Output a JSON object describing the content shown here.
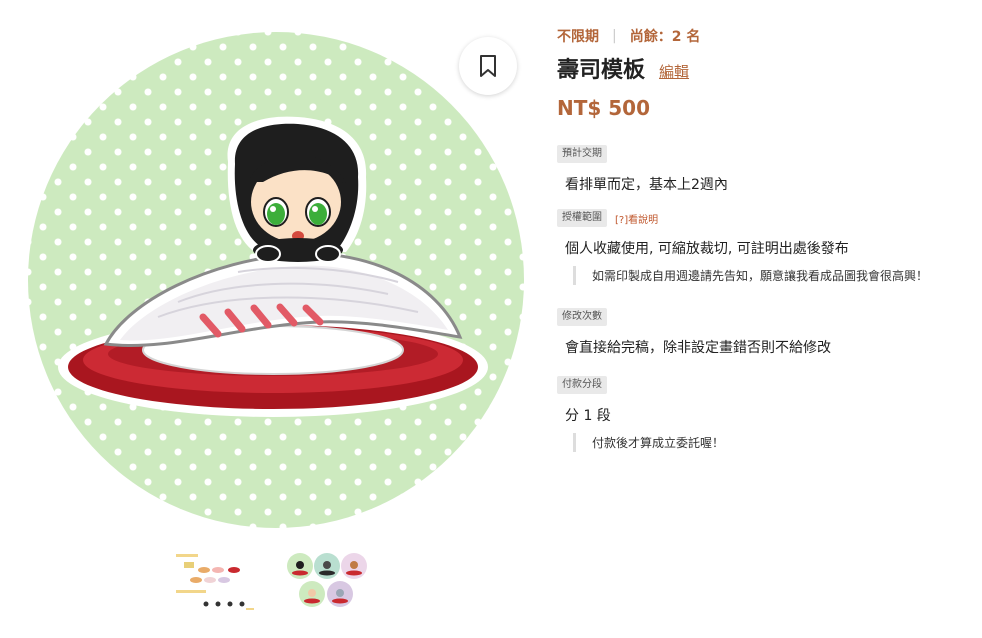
{
  "product": {
    "availability": "不限期",
    "stock": "尚餘：2 名",
    "title": "壽司模板",
    "edit_label": "編輯",
    "price": "NT$ 500"
  },
  "sections": [
    {
      "tag": "預計交期",
      "value": "看排單而定，基本上2週內"
    },
    {
      "tag": "授權範圍",
      "hint": "[?]看說明",
      "value": "個人收藏使用, 可縮放裁切, 可註明出處後發布",
      "note": "如需印製成自用週邊請先告知，願意讓我看成品圖我會很高興！"
    },
    {
      "tag": "修改次數",
      "value": "會直接給完稿，除非設定畫錯否則不給修改"
    },
    {
      "tag": "付款分段",
      "value": "分 1 段",
      "note": "付款後才算成立委託喔！"
    }
  ],
  "icons": {
    "bookmark": "bookmark-icon"
  },
  "colors": {
    "accent": "#b3663a",
    "hint": "#c0582e",
    "background_green": "#cdeabf"
  }
}
